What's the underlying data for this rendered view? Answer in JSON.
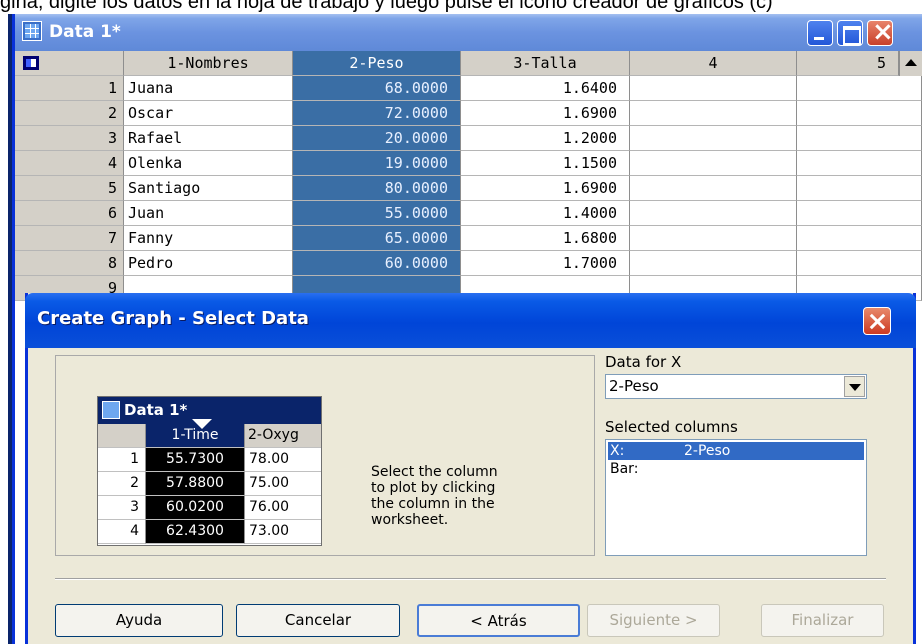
{
  "background_caption": "gina, digite los datos en la hoja de trabajo y luego pulse el icono creador de gráficos                    (c)",
  "worksheet": {
    "title": "Data 1*",
    "columns": [
      "1-Nombres",
      "2-Peso",
      "3-Talla",
      "4",
      "5"
    ],
    "rows": [
      {
        "num": "1",
        "nombre": "Juana",
        "peso": "68.0000",
        "talla": "1.6400"
      },
      {
        "num": "2",
        "nombre": "Oscar",
        "peso": "72.0000",
        "talla": "1.6900"
      },
      {
        "num": "3",
        "nombre": "Rafael",
        "peso": "20.0000",
        "talla": "1.2000"
      },
      {
        "num": "4",
        "nombre": "Olenka",
        "peso": "19.0000",
        "talla": "1.1500"
      },
      {
        "num": "5",
        "nombre": "Santiago",
        "peso": "80.0000",
        "talla": "1.6900"
      },
      {
        "num": "6",
        "nombre": "Juan",
        "peso": "55.0000",
        "talla": "1.4000"
      },
      {
        "num": "7",
        "nombre": "Fanny",
        "peso": "65.0000",
        "talla": "1.6800"
      },
      {
        "num": "8",
        "nombre": "Pedro",
        "peso": "60.0000",
        "talla": "1.7000"
      },
      {
        "num": "9",
        "nombre": "",
        "peso": "",
        "talla": ""
      }
    ]
  },
  "dialog": {
    "title": "Create Graph - Select Data",
    "preview": {
      "title": "Data 1*",
      "columns": [
        "1-Time",
        "2-Oxyg"
      ],
      "rows": [
        {
          "num": "1",
          "a": "55.7300",
          "b": "78.00"
        },
        {
          "num": "2",
          "a": "57.8800",
          "b": "75.00"
        },
        {
          "num": "3",
          "a": "60.0200",
          "b": "76.00"
        },
        {
          "num": "4",
          "a": "62.4300",
          "b": "73.00"
        }
      ]
    },
    "instruction": "Select the column\nto plot by clicking\nthe column in the\nworksheet.",
    "data_for_x_label": "Data for X",
    "data_for_x_value": "2-Peso",
    "selected_columns_label": "Selected columns",
    "selected_columns": [
      {
        "key": "X:",
        "value": "2-Peso",
        "selected": true
      },
      {
        "key": "Bar:",
        "value": "",
        "selected": false
      }
    ],
    "buttons": {
      "help": "Ayuda",
      "cancel": "Cancelar",
      "back": "< Atrás",
      "next": "Siguiente >",
      "finish": "Finalizar"
    }
  },
  "colors": {
    "selected_column": "#3a6ea5",
    "dialog_title": "#0045d8",
    "window_title": "#6b93e0"
  }
}
